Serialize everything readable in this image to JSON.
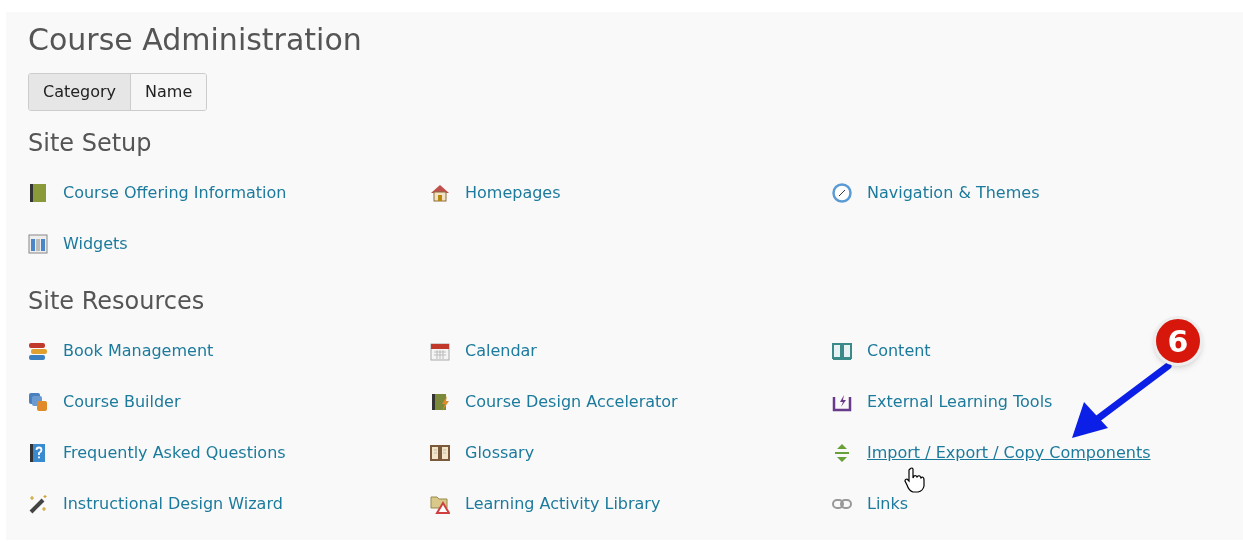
{
  "page": {
    "title": "Course Administration"
  },
  "view_toggle": [
    {
      "label": "Category",
      "selected": true
    },
    {
      "label": "Name",
      "selected": false
    }
  ],
  "sections": [
    {
      "title": "Site Setup",
      "items": [
        {
          "label": "Course Offering Information",
          "kind": "book",
          "hovered": false
        },
        {
          "label": "Homepages",
          "kind": "house",
          "hovered": false
        },
        {
          "label": "Navigation & Themes",
          "kind": "compass",
          "hovered": false
        },
        {
          "label": "Widgets",
          "kind": "widgets",
          "hovered": false
        }
      ]
    },
    {
      "title": "Site Resources",
      "items": [
        {
          "label": "Book Management",
          "kind": "books",
          "hovered": false
        },
        {
          "label": "Calendar",
          "kind": "calendar",
          "hovered": false
        },
        {
          "label": "Content",
          "kind": "open-book",
          "hovered": false
        },
        {
          "label": "Course Builder",
          "kind": "cubes",
          "hovered": false
        },
        {
          "label": "Course Design Accelerator",
          "kind": "book-bolt",
          "hovered": false
        },
        {
          "label": "External Learning Tools",
          "kind": "tool-tray",
          "hovered": false
        },
        {
          "label": "Frequently Asked Questions",
          "kind": "faq",
          "hovered": false
        },
        {
          "label": "Glossary",
          "kind": "glossary",
          "hovered": false
        },
        {
          "label": "Import / Export / Copy Components",
          "kind": "arrows",
          "hovered": true
        },
        {
          "label": "Instructional Design Wizard",
          "kind": "wand",
          "hovered": false
        },
        {
          "label": "Learning Activity Library",
          "kind": "folder",
          "hovered": false
        },
        {
          "label": "Links",
          "kind": "chain",
          "hovered": false
        }
      ]
    }
  ],
  "callout": {
    "number": "6"
  }
}
